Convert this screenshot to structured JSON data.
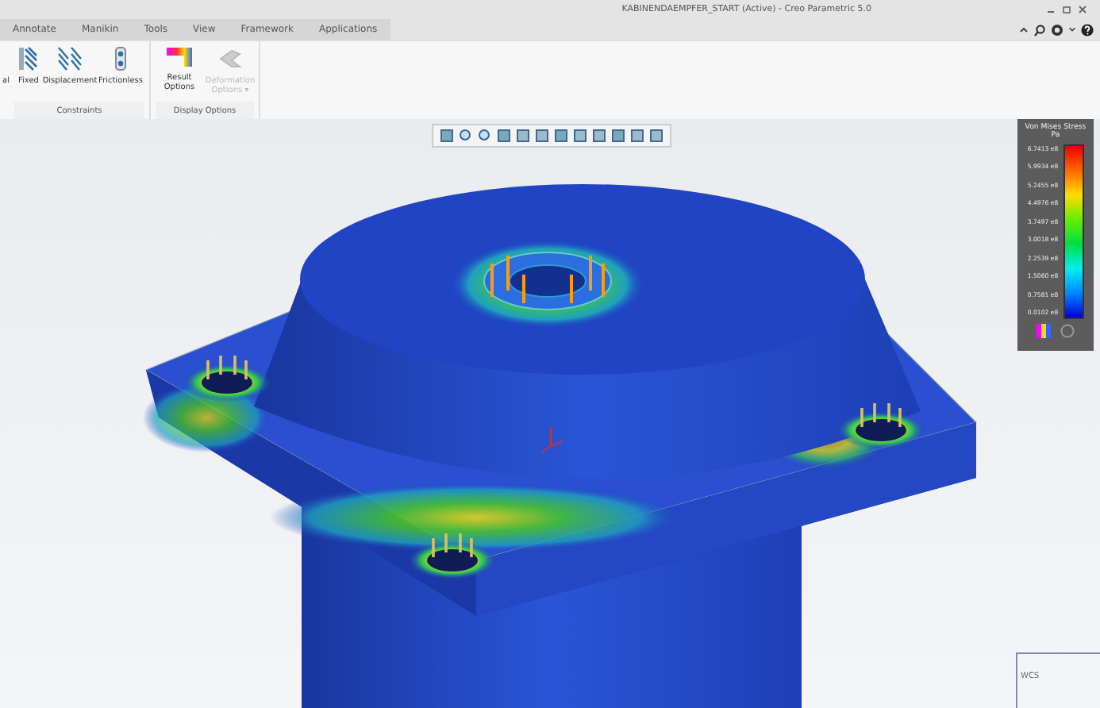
{
  "window": {
    "title": "KABINENDAEMPFER_START (Active) - Creo Parametric 5.0"
  },
  "tabs": [
    {
      "label": "Annotate",
      "selected": false
    },
    {
      "label": "Manikin",
      "selected": false
    },
    {
      "label": "Tools",
      "selected": false
    },
    {
      "label": "View",
      "selected": false
    },
    {
      "label": "Framework",
      "selected": false
    },
    {
      "label": "Applications",
      "selected": false
    }
  ],
  "ribbon": {
    "cut_label": "al",
    "groups": [
      {
        "title": "Constraints",
        "buttons": [
          {
            "kind": "fixed",
            "label": "Fixed",
            "disabled": false
          },
          {
            "kind": "displacement",
            "label": "Displacement",
            "disabled": false
          },
          {
            "kind": "frictionless",
            "label": "Frictionless",
            "disabled": false
          }
        ]
      },
      {
        "title": "Display Options",
        "buttons": [
          {
            "kind": "result",
            "label": "Result Options",
            "disabled": false
          },
          {
            "kind": "deformation",
            "label": "Deformation Options ▾",
            "disabled": true
          }
        ]
      }
    ]
  },
  "legend": {
    "title": "Von Mises Stress",
    "unit": "Pa",
    "labels": [
      "6.7413 e8",
      "5.9934 e8",
      "5.2455 e8",
      "4.4976 e8",
      "3.7497 e8",
      "3.0018 e8",
      "2.2539 e8",
      "1.5060 e8",
      "0.7581 e8",
      "0.0102 e8"
    ]
  },
  "wcs": {
    "label": "WCS"
  }
}
